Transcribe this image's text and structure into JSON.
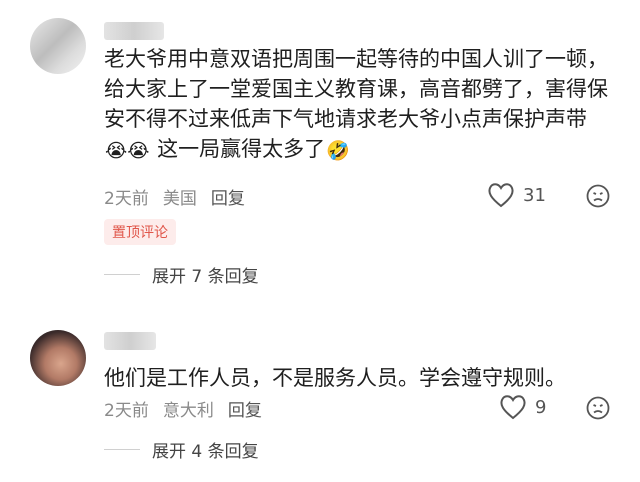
{
  "comments": [
    {
      "text_before_emoji": "老大爷用中意双语把周围一起等待的中国人训了一顿，给大家上了一堂爱国主义教育课，高音都劈了，害得保安不得不过来低声下气地请求老大爷小点声保护声带",
      "emoji_1": "😭😭",
      "text_after_emoji": " 这一局赢得太多了",
      "emoji_2": "🤣",
      "time": "2天前",
      "location": "美国",
      "reply_label": "回复",
      "likes": "31",
      "pin_label": "置顶评论",
      "expand_label": "展开 7 条回复"
    },
    {
      "text": "他们是工作人员，不是服务人员。学会遵守规则。",
      "time": "2天前",
      "location": "意大利",
      "reply_label": "回复",
      "likes": "9",
      "expand_label": "展开 4 条回复"
    }
  ],
  "colors": {
    "pin_text": "#e0564a",
    "pin_bg": "#fdeceb",
    "meta": "#8a8a8a"
  },
  "icons": {
    "like": "heart-outline-icon",
    "dislike": "frown-face-icon"
  }
}
